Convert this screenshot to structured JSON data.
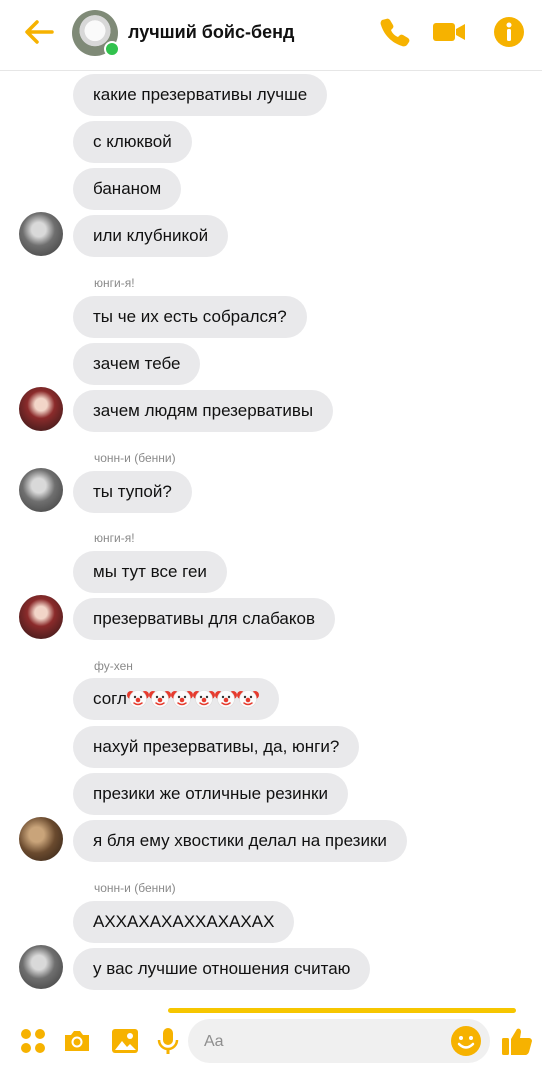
{
  "header": {
    "title": "лучший бойс-бенд",
    "accent_color": "#F6B200",
    "online_color": "#31C24D",
    "icons": [
      "back-arrow-icon",
      "phone-icon",
      "video-camera-icon",
      "info-icon"
    ]
  },
  "messages": [
    {
      "text": "какие презервативы лучше"
    },
    {
      "text": "с клюквой"
    },
    {
      "text": "бананом"
    },
    {
      "text": "или клубникой"
    },
    {
      "sender": "юнги-я!",
      "text": "ты че их есть собрался?"
    },
    {
      "text": "зачем тебе"
    },
    {
      "text": "зачем людям презервативы"
    },
    {
      "sender": "чонн-и (бенни)",
      "text": "ты тупой?"
    },
    {
      "sender": "юнги-я!",
      "text": "мы тут все геи"
    },
    {
      "text": "презервативы для слабаков"
    },
    {
      "sender": "фу-хен",
      "text": "согл",
      "emoji": "clown-face-icon",
      "emoji_count": 6
    },
    {
      "text": "нахуй презервативы, да, юнги?"
    },
    {
      "text": "презики же отличные резинки"
    },
    {
      "text": "я бля ему хвостики делал на презики"
    },
    {
      "sender": "чонн-и (бенни)",
      "text": "АХХАХАХАХХАХАХАХ"
    },
    {
      "text": "у вас лучшие отношения считаю"
    }
  ],
  "composer": {
    "placeholder": "Aa",
    "icons": [
      "apps-grid-icon",
      "camera-icon",
      "gallery-icon",
      "microphone-icon",
      "smiley-icon",
      "thumbs-up-icon"
    ]
  }
}
